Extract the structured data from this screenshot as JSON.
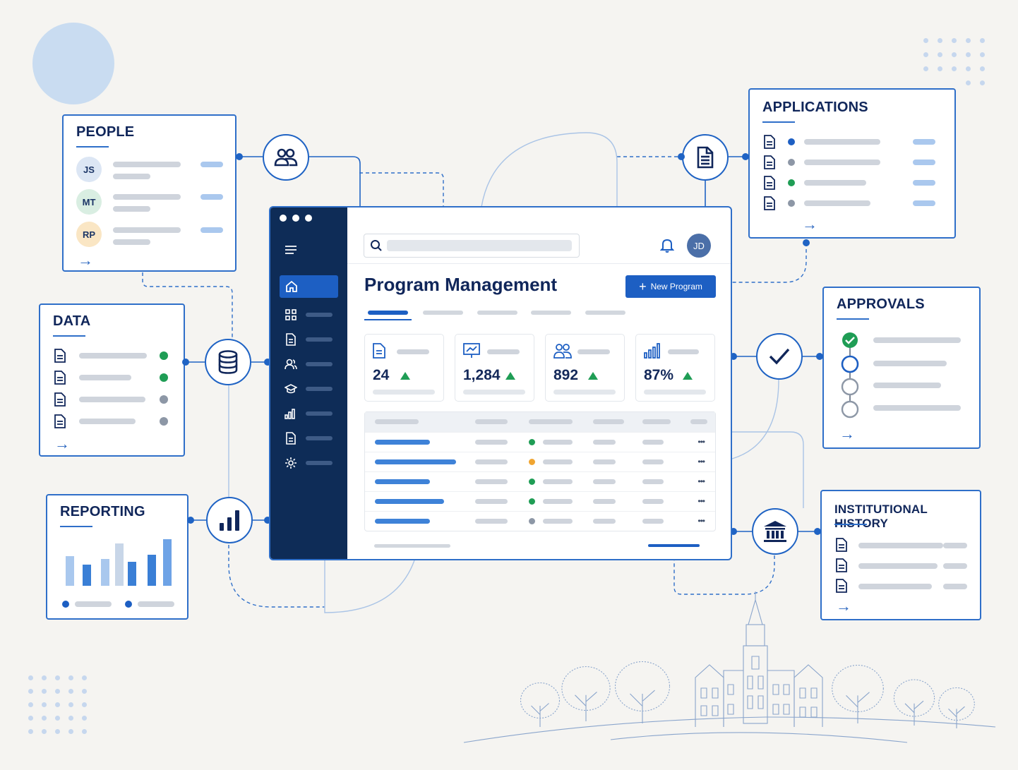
{
  "cards": {
    "people": {
      "title": "PEOPLE",
      "avatars": [
        "JS",
        "MT",
        "RP"
      ]
    },
    "data": {
      "title": "DATA"
    },
    "reporting": {
      "title": "REPORTING"
    },
    "applications": {
      "title": "APPLICATIONS"
    },
    "approvals": {
      "title": "APPROVALS"
    },
    "history": {
      "title": "INSTITUTIONAL HISTORY"
    }
  },
  "hub_icons": [
    "people-icon",
    "database-icon",
    "bar-chart-icon",
    "document-icon",
    "checkmark-icon",
    "institution-icon"
  ],
  "window": {
    "user_initials": "JD",
    "title": "Program Management",
    "new_button": "New Program",
    "new_button_icon": "+",
    "stats": [
      {
        "icon": "document-icon",
        "value": "24"
      },
      {
        "icon": "monitor-chart-icon",
        "value": "1,284"
      },
      {
        "icon": "people-icon",
        "value": "892"
      },
      {
        "icon": "signal-chart-icon",
        "value": "87%"
      }
    ],
    "table_row_status": [
      "green",
      "orange",
      "green",
      "green",
      "gray"
    ],
    "ellipsis": "•••"
  },
  "colors": {
    "primary": "#1d5fc3",
    "navy": "#0e2c57",
    "green": "#1f9d55",
    "orange": "#f0a531",
    "gray": "#8d97a6",
    "background": "#f5f4f1"
  }
}
